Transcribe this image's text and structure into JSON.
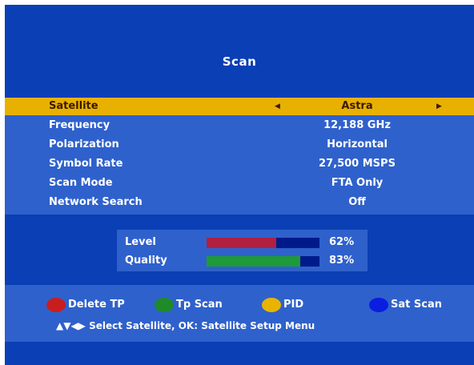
{
  "screen": {
    "title": "Scan"
  },
  "menu": {
    "rows": [
      {
        "label": "Satellite",
        "value": "Astra",
        "selected": true
      },
      {
        "label": "Frequency",
        "value": "12,188 GHz"
      },
      {
        "label": "Polarization",
        "value": "Horizontal"
      },
      {
        "label": "Symbol Rate",
        "value": "27,500 MSPS"
      },
      {
        "label": "Scan Mode",
        "value": "FTA Only"
      },
      {
        "label": "Network Search",
        "value": "Off"
      }
    ]
  },
  "signal": {
    "level": {
      "label": "Level",
      "percent": 62,
      "display": "62%",
      "color": "#b02040"
    },
    "quality": {
      "label": "Quality",
      "percent": 83,
      "display": "83%",
      "color": "#1e9a3a"
    }
  },
  "footer": {
    "buttons": [
      {
        "label": "Delete TP",
        "color": "#c81e1e",
        "icon": "red-button-icon"
      },
      {
        "label": "Tp Scan",
        "color": "#1e8a2a",
        "icon": "green-button-icon"
      },
      {
        "label": "PID",
        "color": "#e8b400",
        "icon": "yellow-button-icon"
      },
      {
        "label": "Sat Scan",
        "color": "#0a1ee0",
        "icon": "blue-button-icon"
      }
    ],
    "hint": "▲▼◀▶ Select Satellite, OK: Satellite Setup Menu"
  },
  "colors": {
    "background": "#0a3fb5",
    "panel": "#2f61cc",
    "highlight": "#e8b100",
    "bar_track": "#001a8a"
  }
}
